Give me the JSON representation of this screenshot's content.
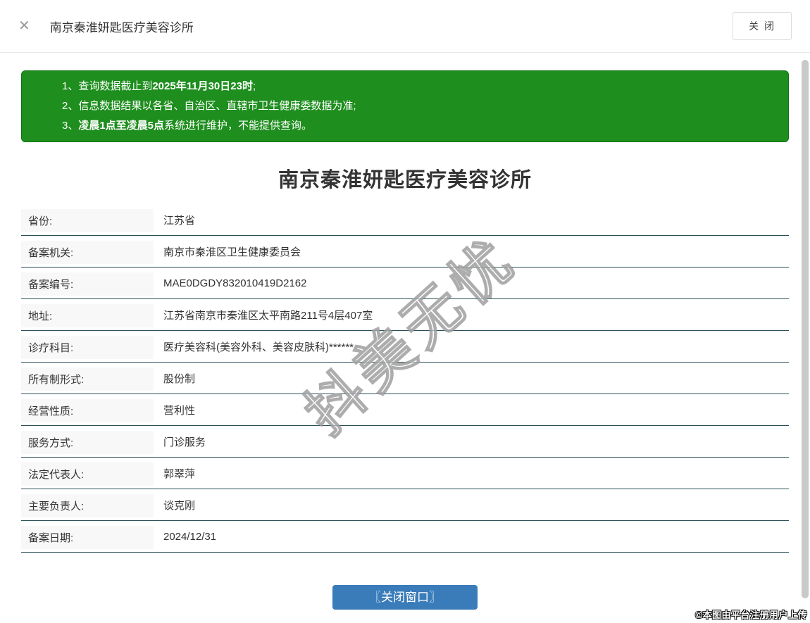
{
  "header": {
    "close_icon": "✕",
    "title": "南京秦淮妍匙医疗美容诊所",
    "close_button_label": "关 闭"
  },
  "notice": {
    "lines": [
      {
        "pre": "1、查询数据截止到",
        "bold": "2025年11月30日23时",
        "post": ";"
      },
      {
        "pre": "2、信息数据结果以各省、自治区、直辖市卫生健康委数据为准;",
        "bold": "",
        "post": ""
      },
      {
        "pre": "3、",
        "bold": "凌晨1点至凌晨5点",
        "post": "系统进行维护，不能提供查询。"
      }
    ]
  },
  "detail": {
    "title": "南京秦淮妍匙医疗美容诊所",
    "rows": [
      {
        "label": "省份:",
        "value": "江苏省"
      },
      {
        "label": "备案机关:",
        "value": "南京市秦淮区卫生健康委员会"
      },
      {
        "label": "备案编号:",
        "value": "MAE0DGDY832010419D2162"
      },
      {
        "label": "地址:",
        "value": "江苏省南京市秦淮区太平南路211号4层407室"
      },
      {
        "label": "诊疗科目:",
        "value": "医疗美容科(美容外科、美容皮肤科)******"
      },
      {
        "label": "所有制形式:",
        "value": "股份制"
      },
      {
        "label": "经营性质:",
        "value": "营利性"
      },
      {
        "label": "服务方式:",
        "value": "门诊服务"
      },
      {
        "label": "法定代表人:",
        "value": "郭翠萍"
      },
      {
        "label": "主要负责人:",
        "value": "谈克刚"
      },
      {
        "label": "备案日期:",
        "value": "2024/12/31"
      }
    ]
  },
  "footer": {
    "close_window_button": "〖关闭窗口〗"
  },
  "watermark": {
    "diagonal_text": "抖美无忧",
    "credit_text": "©本图由平台注册用户上传"
  },
  "colors": {
    "notice_green": "#1e8e1e",
    "row_divider": "#2b5059",
    "button_blue": "#3a7cba"
  }
}
